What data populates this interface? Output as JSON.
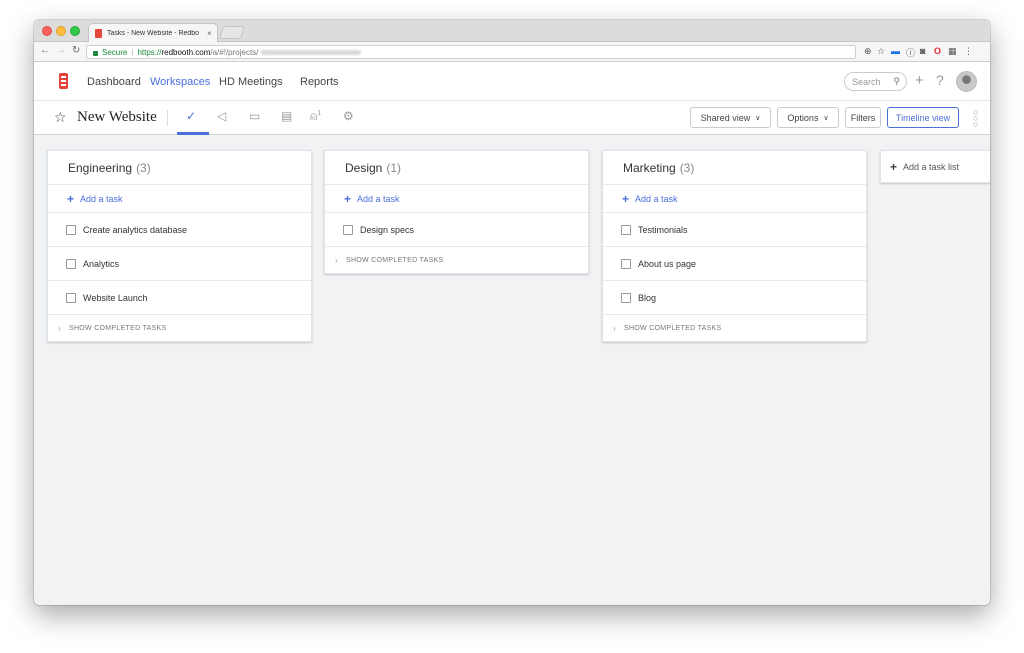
{
  "browser": {
    "tab_title": "Tasks - New Website - Redbo",
    "tab_close": "×",
    "secure_label": "Secure",
    "url_proto": "https://",
    "url_host": "redbooth.com",
    "url_path": "/a/#!/projects/"
  },
  "app": {
    "nav": [
      "Dashboard",
      "Workspaces",
      "HD Meetings",
      "Reports"
    ],
    "active_nav": "Workspaces",
    "search_placeholder": "Search",
    "accent_color": "#4a6fd9",
    "brand_color": "#e3423a"
  },
  "project": {
    "title": "New Website",
    "people_count": "1",
    "buttons": {
      "shared_view": "Shared view",
      "options": "Options",
      "filters": "Filters",
      "timeline_view": "Timeline view"
    }
  },
  "board": {
    "add_task_label": "Add a task",
    "show_completed_label": "SHOW COMPLETED TASKS",
    "add_list_label": "Add a task list",
    "columns": [
      {
        "name": "Engineering",
        "count": "(3)",
        "tasks": [
          "Create analytics database",
          "Analytics",
          "Website Launch"
        ]
      },
      {
        "name": "Design",
        "count": "(1)",
        "tasks": [
          "Design specs"
        ]
      },
      {
        "name": "Marketing",
        "count": "(3)",
        "tasks": [
          "Testimonials",
          "About us page",
          "Blog"
        ]
      }
    ]
  }
}
